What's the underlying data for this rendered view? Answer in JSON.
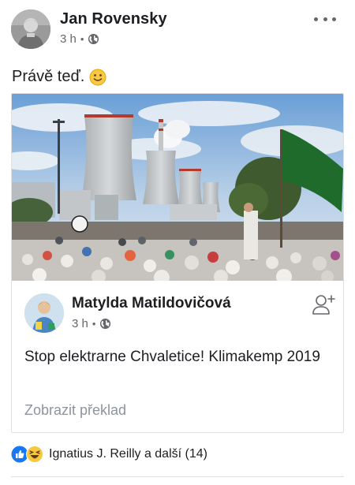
{
  "post": {
    "author": "Jan Rovensky",
    "time": "3 h",
    "separator": "•",
    "audience_icon": "globe-icon",
    "more_icon": "more-horizontal-icon",
    "text": "Právě teď.",
    "emoji": "slightly-smiling-face-emoji"
  },
  "shared": {
    "author": "Matylda Matildovičová",
    "time": "3 h",
    "separator": "•",
    "audience_icon": "globe-icon",
    "action_icon": "add-friend-icon",
    "text": "Stop elektrarne Chvaletice! Klimakemp 2019",
    "translate_label": "Zobrazit překlad",
    "image_icon": "protest-at-power-plant-photo"
  },
  "reactions": {
    "icons": [
      "like-reaction-icon",
      "haha-reaction-icon"
    ],
    "summary": "Ignatius J. Reilly a další (14)"
  },
  "colors": {
    "text_primary": "#1c1e21",
    "text_secondary": "#65676b",
    "text_muted": "#8d949e",
    "like_blue": "#1877f2",
    "haha_yellow": "#f7c843",
    "border": "#dddfe2"
  }
}
